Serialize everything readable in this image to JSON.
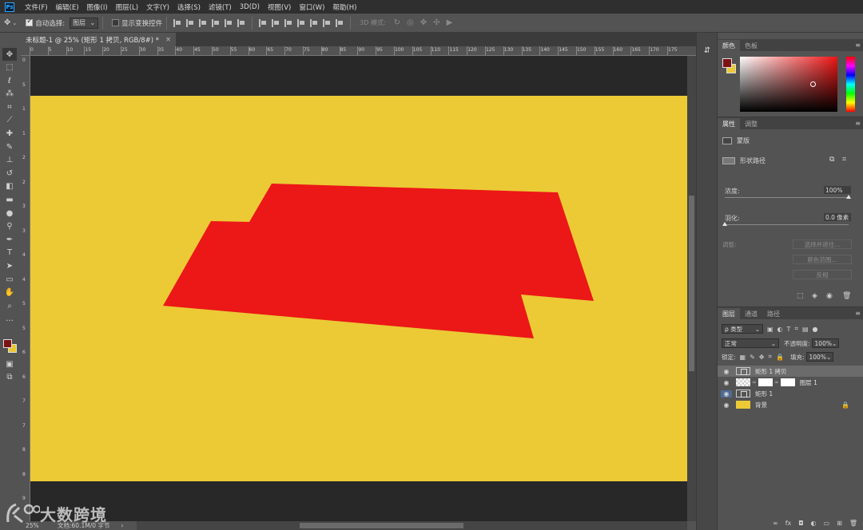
{
  "app": {
    "logo": "Ps"
  },
  "menu": [
    "文件(F)",
    "编辑(E)",
    "图像(I)",
    "图层(L)",
    "文字(Y)",
    "选择(S)",
    "滤镜(T)",
    "3D(D)",
    "视图(V)",
    "窗口(W)",
    "帮助(H)"
  ],
  "options": {
    "auto_select_label": "自动选择:",
    "auto_select_checked": true,
    "auto_select_value": "图层",
    "show_transform_label": "显示变换控件",
    "show_transform_checked": false,
    "mode_3d_label": "3D 模式:"
  },
  "document_tab": {
    "title": "未标题-1 @ 25% (矩形 1 拷贝, RGB/8#) *",
    "close": "×"
  },
  "ruler": {
    "top_labels": [
      "0",
      "5",
      "10",
      "15",
      "20",
      "25",
      "30",
      "35",
      "40",
      "45",
      "50",
      "55",
      "60",
      "65",
      "70",
      "75",
      "80",
      "85",
      "90",
      "95",
      "100",
      "105",
      "110",
      "115",
      "120",
      "125",
      "130",
      "135",
      "140",
      "145",
      "150",
      "155",
      "160",
      "165",
      "170",
      "175"
    ],
    "left_labels": [
      "0",
      "5",
      "1",
      "1",
      "2",
      "2",
      "3",
      "3",
      "4",
      "4",
      "5",
      "5",
      "6",
      "6",
      "7",
      "7",
      "8",
      "8",
      "9"
    ]
  },
  "canvas": {
    "pasteboard_color": "#282828",
    "document_color": "#ebca35",
    "shape_color": "#ec1717"
  },
  "status": {
    "zoom": "25%",
    "doc_info": "文档:60.1M/0 字节",
    "arrow": "›"
  },
  "watermark": {
    "text": "大数跨境"
  },
  "panels": {
    "color": {
      "tabs": [
        "颜色",
        "色板"
      ],
      "fg": "#7d1212",
      "bg": "#ebca35"
    },
    "properties": {
      "tabs": [
        "属性",
        "调整"
      ],
      "mask_label": "蒙版",
      "shape_path_label": "形状路径",
      "density_label": "浓度:",
      "density_value": "100%",
      "feather_label": "羽化:",
      "feather_value": "0.0 像素",
      "adjust_label": "调整:",
      "buttons": [
        "选择并遮住...",
        "颜色范围...",
        "反相"
      ]
    },
    "layers": {
      "tabs": [
        "图层",
        "通道",
        "路径"
      ],
      "filter_label": "ρ 类型",
      "blend_mode": "正常",
      "opacity_label": "不透明度:",
      "opacity_value": "100%",
      "lock_label": "锁定:",
      "fill_label": "填充:",
      "fill_value": "100%",
      "items": [
        {
          "name": "矩形 1 拷贝",
          "selected": true
        },
        {
          "name": "图层 1",
          "selected": false
        },
        {
          "name": "矩形 1",
          "selected": false
        },
        {
          "name": "背景",
          "selected": false
        }
      ]
    }
  }
}
